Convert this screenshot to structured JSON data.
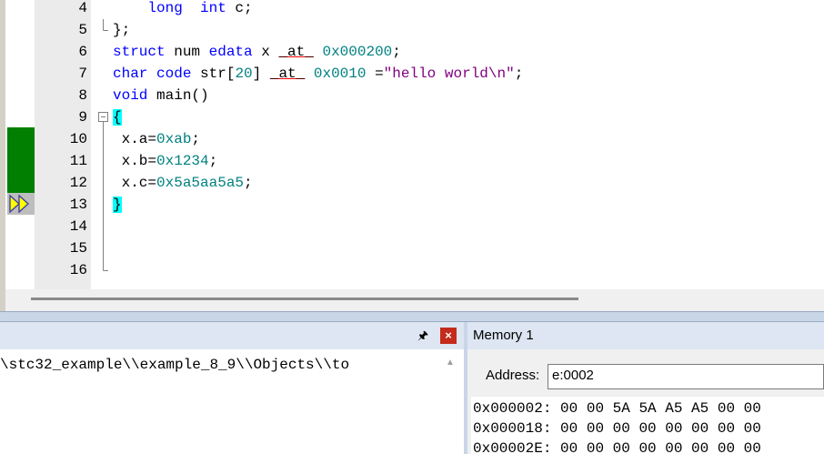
{
  "editor": {
    "lines": [
      {
        "num": "4",
        "code": "    long  int c;",
        "fold": "none"
      },
      {
        "num": "5",
        "code": "};",
        "fold": "end"
      },
      {
        "num": "6",
        "code": "struct num edata x _at_ 0x000200;",
        "fold": "none"
      },
      {
        "num": "7",
        "code": "char code str[20] _at_ 0x0010 =\"hello world\\n\";",
        "fold": "none"
      },
      {
        "num": "8",
        "code": "void main()",
        "fold": "none"
      },
      {
        "num": "9",
        "code": "{",
        "fold": "start"
      },
      {
        "num": "10",
        "code": " x.a=0xab;",
        "fold": "line"
      },
      {
        "num": "11",
        "code": " x.b=0x1234;",
        "fold": "line"
      },
      {
        "num": "12",
        "code": " x.c=0x5a5aa5a5;",
        "fold": "line"
      },
      {
        "num": "13",
        "code": "}",
        "fold": "line"
      },
      {
        "num": "14",
        "code": "",
        "fold": "line"
      },
      {
        "num": "15",
        "code": "",
        "fold": "line"
      },
      {
        "num": "16",
        "code": "",
        "fold": "end"
      }
    ],
    "colors": {
      "keyword": "#0000ff",
      "number": "#008080",
      "string": "#800080",
      "exec_marker": "#007f00",
      "current_line_arrow": "#ffff00",
      "brace_highlight": "#00ffff"
    }
  },
  "output_panel": {
    "path_text": "\\stc32_example\\\\example_8_9\\\\Objects\\\\to",
    "pin_icon": "pin-icon",
    "close_label": "×"
  },
  "memory": {
    "title": "Memory 1",
    "address_label": "Address:",
    "address_value": "e:0002",
    "rows": [
      {
        "addr": "0x000002:",
        "bytes": "00 00 5A 5A A5 A5 00 00"
      },
      {
        "addr": "0x000018:",
        "bytes": "00 00 00 00 00 00 00 00"
      },
      {
        "addr": "0x00002E:",
        "bytes": "00 00 00 00 00 00 00 00"
      }
    ]
  }
}
